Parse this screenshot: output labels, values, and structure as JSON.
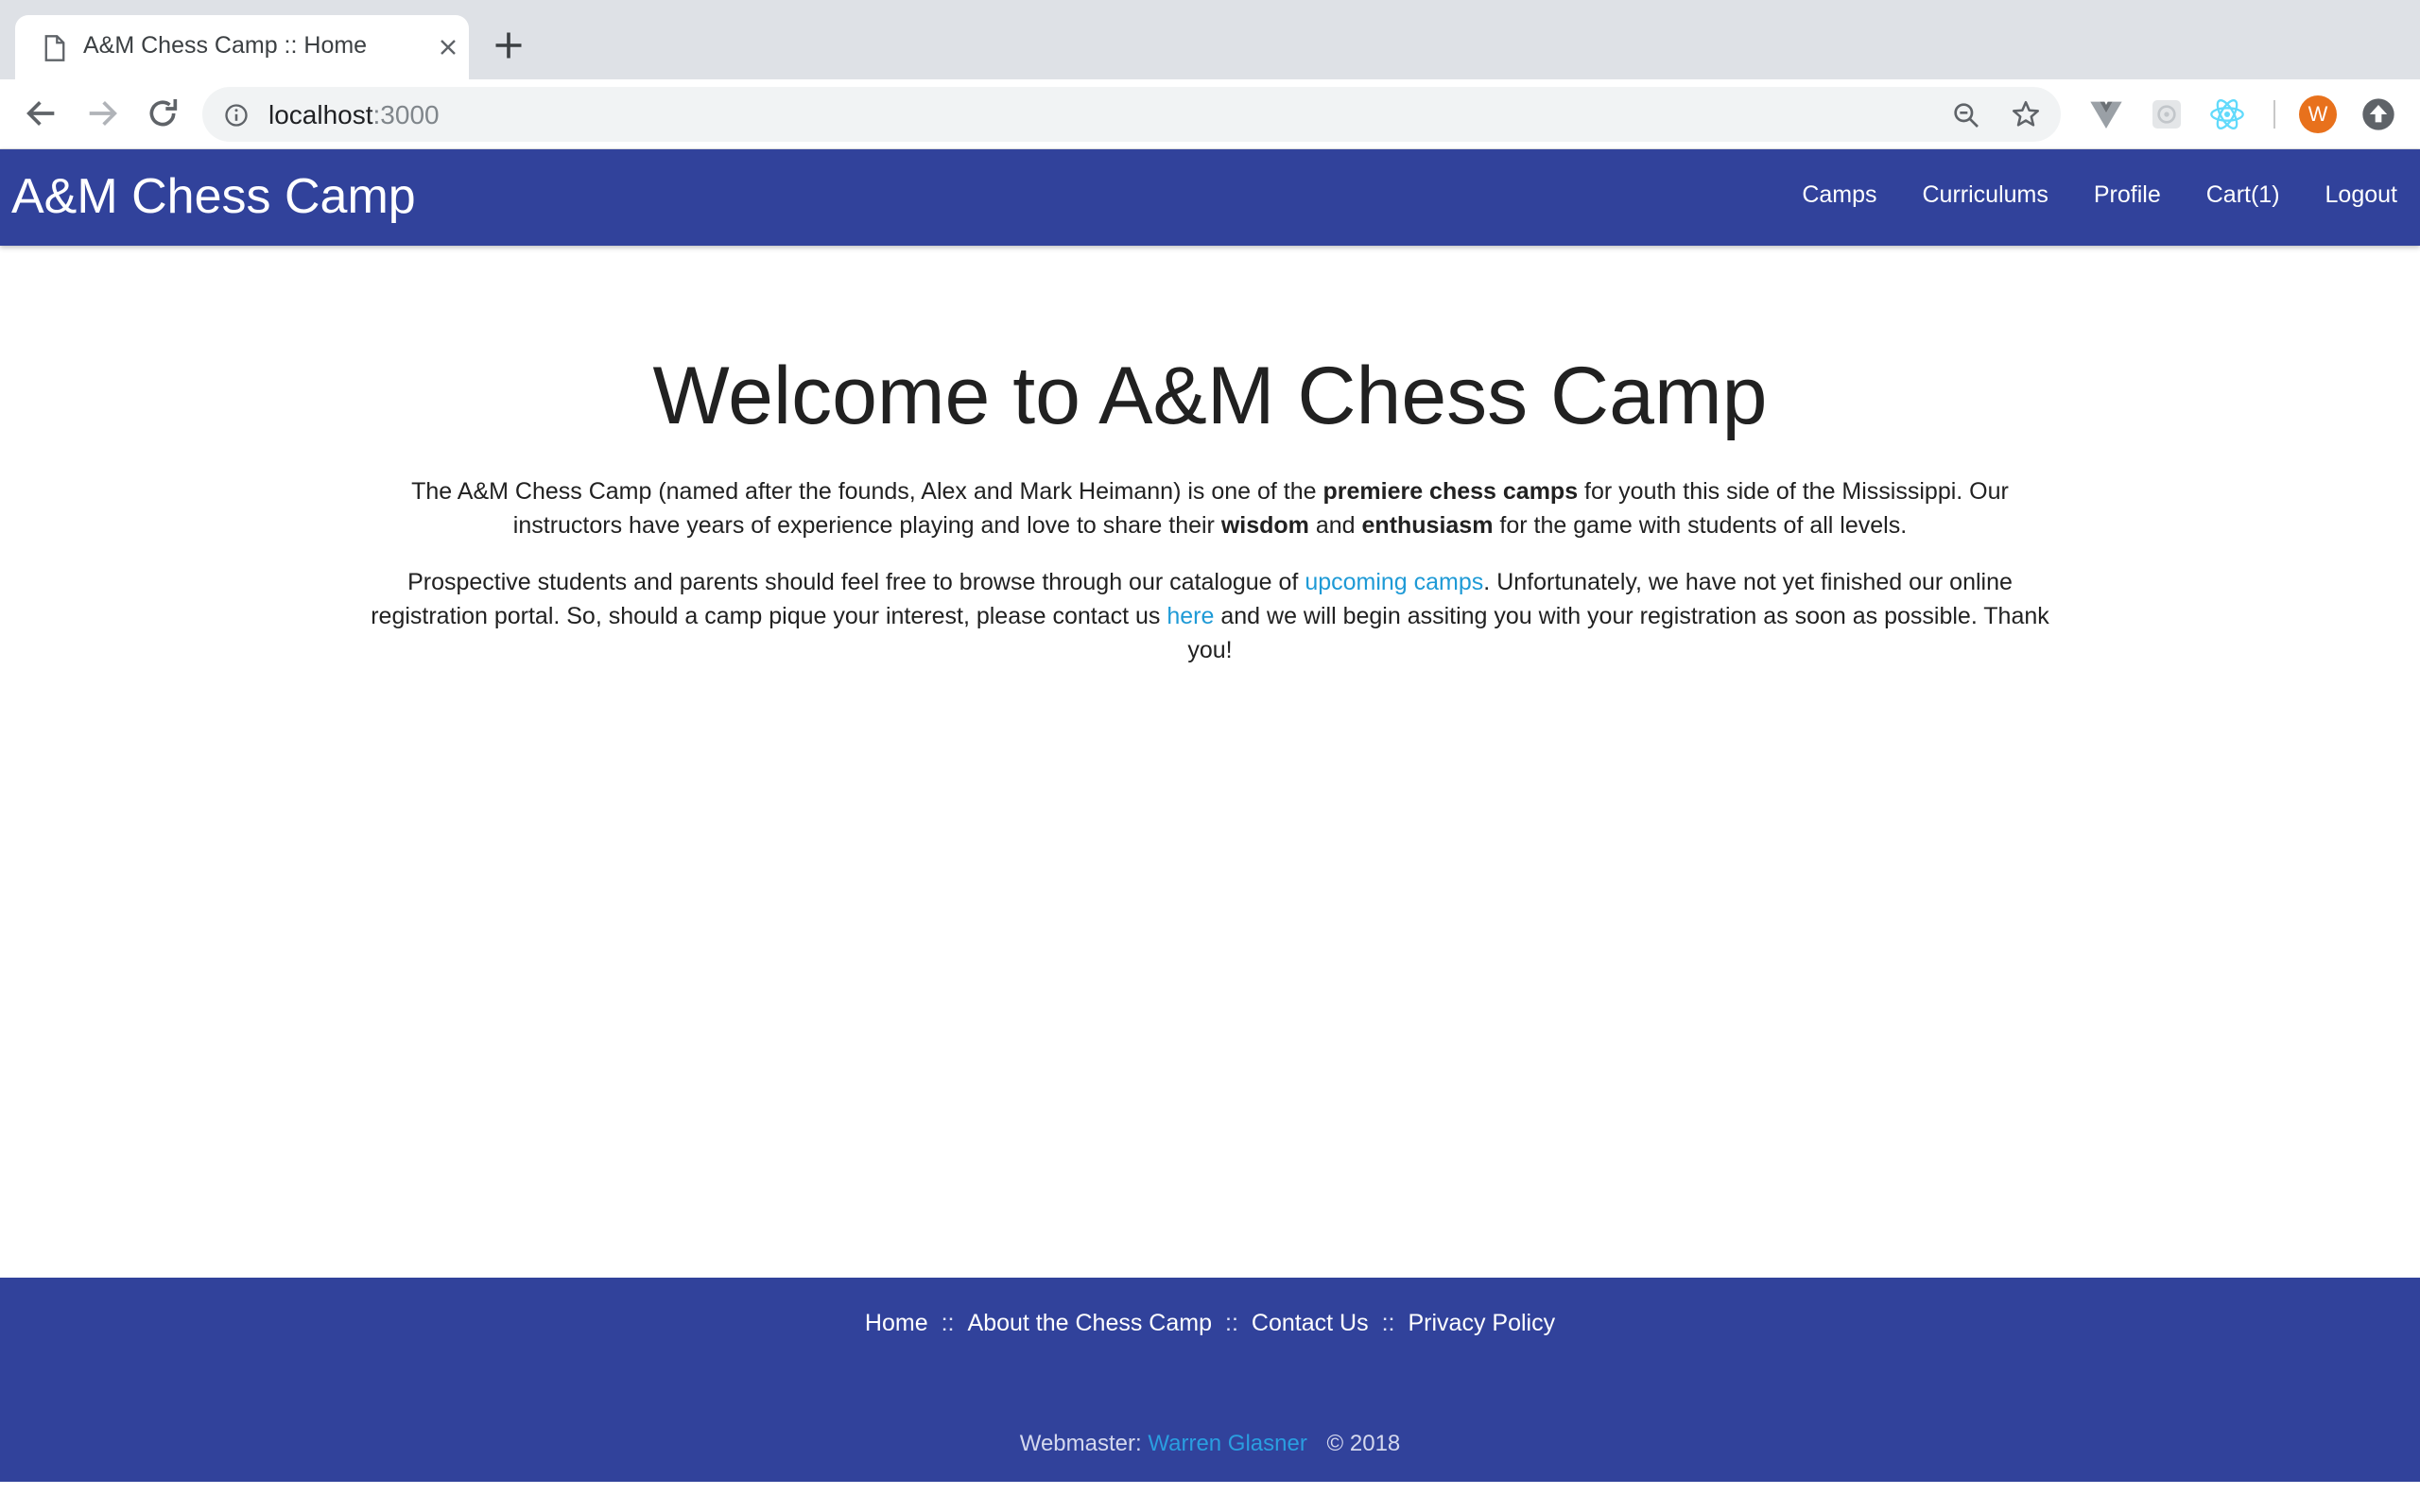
{
  "browser": {
    "tab": {
      "title": "A&M Chess Camp :: Home",
      "favicon": "document-icon"
    },
    "url": {
      "host": "localhost",
      "port": ":3000"
    },
    "extensions": [
      "vue-devtools-icon",
      "redux-devtools-icon",
      "react-devtools-icon"
    ],
    "profile_initial": "W",
    "colors": {
      "tabstrip": "#dee1e6",
      "omnibox": "#f1f3f4",
      "avatar": "#e8711c"
    }
  },
  "header": {
    "brand": "A&M Chess Camp",
    "nav": [
      {
        "label": "Camps"
      },
      {
        "label": "Curriculums"
      },
      {
        "label": "Profile"
      },
      {
        "label": "Cart(1)"
      },
      {
        "label": "Logout"
      }
    ],
    "color": "#31429b"
  },
  "main": {
    "title": "Welcome to A&M Chess Camp",
    "para1": {
      "t1": "The A&M Chess Camp (named after the founds, Alex and Mark Heimann) is one of the ",
      "b1": "premiere chess camps",
      "t2": " for youth this side of the Mississippi. Our instructors have years of experience playing and love to share their ",
      "b2": "wisdom",
      "t3": " and ",
      "b3": "enthusiasm",
      "t4": " for the game with students of all levels."
    },
    "para2": {
      "t1": "Prospective students and parents should feel free to browse through our catalogue of ",
      "link1": "upcoming camps",
      "t2": ". Unfortunately, we have not yet finished our online registration portal. So, should a camp pique your interest, please contact us ",
      "link2": "here",
      "t3": " and we will begin assiting you with your registration as soon as possible. Thank you!"
    },
    "link_color": "#1e9ad6"
  },
  "footer": {
    "links": [
      {
        "label": "Home"
      },
      {
        "label": "About the Chess Camp"
      },
      {
        "label": "Contact Us"
      },
      {
        "label": "Privacy Policy"
      }
    ],
    "separator": "::",
    "webmaster_label": "Webmaster:",
    "webmaster_name": "Warren Glasner",
    "copyright": "© 2018"
  }
}
